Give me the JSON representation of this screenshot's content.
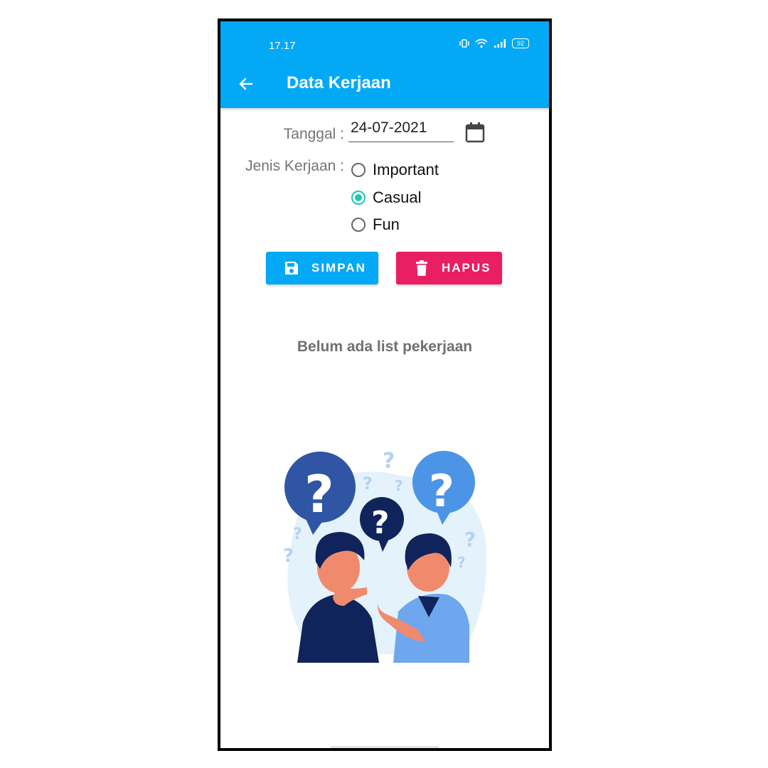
{
  "status_bar": {
    "time": "17.17",
    "battery": "92"
  },
  "app_bar": {
    "title": "Data Kerjaan",
    "back_icon": "arrow-left-icon"
  },
  "form": {
    "date_label": "Tanggal :",
    "date_value": "24-07-2021",
    "calendar_icon": "calendar-icon",
    "type_label": "Jenis Kerjaan :",
    "options": [
      {
        "label": "Important",
        "checked": false
      },
      {
        "label": "Casual",
        "checked": true
      },
      {
        "label": "Fun",
        "checked": false
      }
    ]
  },
  "buttons": {
    "save_label": "SIMPAN",
    "delete_label": "HAPUS"
  },
  "empty_state": {
    "message": "Belum ada list pekerjaan"
  },
  "colors": {
    "primary": "#03A9F4",
    "accent": "#E91E63",
    "radio_checked": "#1EC8B5"
  }
}
